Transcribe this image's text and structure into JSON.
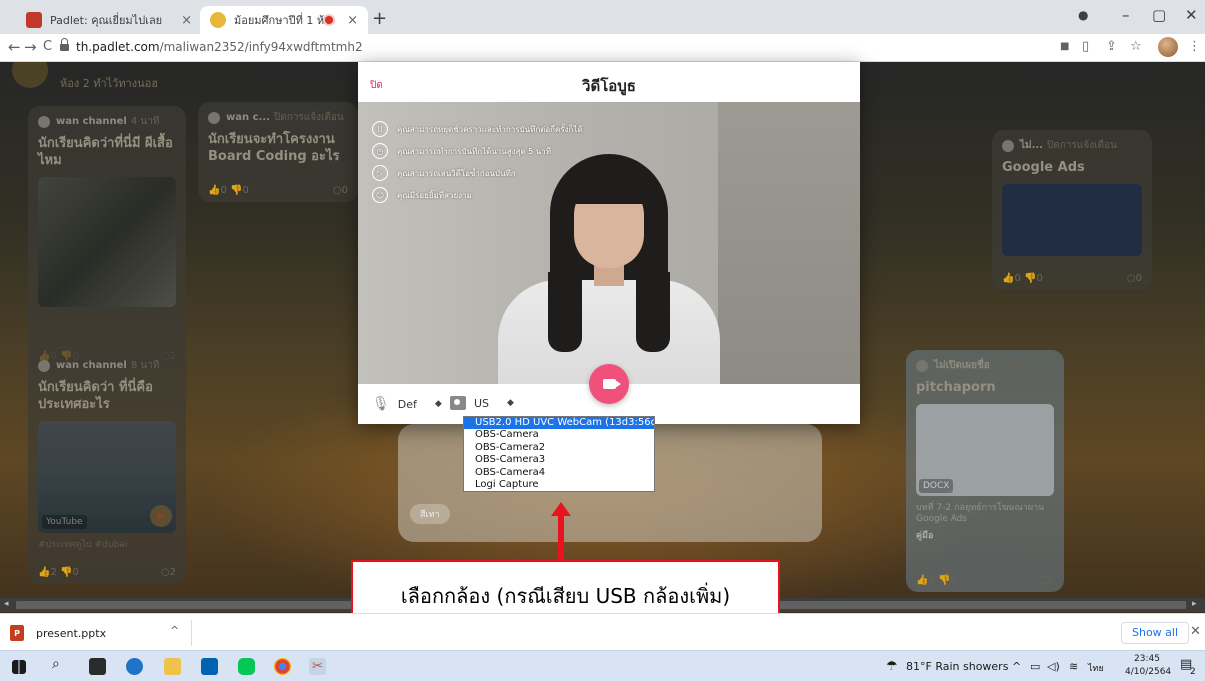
{
  "browser": {
    "tabs": [
      {
        "title": "Padlet: คุณเยี่ยมไปเลย",
        "close": "×"
      },
      {
        "title": "ม้อยมศึกษาปีที่ 1 ห้อง 2",
        "close": "×"
      }
    ],
    "new_tab": "+",
    "url_domain": "th.padlet.com",
    "url_path": "/maliwan2352/infy94xwdftmtmh2",
    "window_controls": {
      "minimize": "–",
      "maximize": "▢",
      "close": "✕"
    },
    "nav": {
      "back": "←",
      "forward": "→",
      "reload": "C"
    },
    "star": "☆",
    "menu": "⋮"
  },
  "padlet": {
    "subtitle": "ห้อง 2 ทำไว้ทางนอฮ",
    "cards": [
      {
        "author": "wan channel",
        "time": "4 นาที",
        "title": "นักเรียนคิดว่าที่นี่มี ผีเสื้อไหม",
        "likes": "0",
        "dislikes": "0",
        "comments": "2"
      },
      {
        "author": "wan c...",
        "time": "ปิดการแจ้งเตือน",
        "title": "นักเรียนจะทำโครงงาน Board Coding อะไร",
        "likes": "0",
        "dislikes": "0",
        "comments": "0"
      },
      {
        "author": "wan channel",
        "time": "8 นาที",
        "title": "นักเรียนคิดว่า ที่นี่คือ ประเทศอะไร",
        "badge": "YouTube",
        "tags": "#ประเทศดูไบ #dubai",
        "likes": "2",
        "dislikes": "0",
        "comments": "2"
      },
      {
        "author": "ไม่...",
        "time": "ปิดการแจ้งเตือน",
        "title": "Google Ads",
        "likes": "0",
        "dislikes": "0",
        "comments": "0"
      },
      {
        "author": "ไม่เปิดเผยชื่อ",
        "time": "8 นาที",
        "title": "pitchaporn",
        "badge": "DOCX",
        "desc": "บทที่ 7-2 กลยุทธ์การโฆษณาผ่าน Google Ads",
        "footer": "คู่มือ",
        "likes": "0",
        "dislikes": "0",
        "comments": "0"
      }
    ],
    "bg_chip": "สีเทา"
  },
  "modal": {
    "close_label": "ปิด",
    "title": "วิดีโอบูธ",
    "tips": [
      {
        "icon": "II",
        "text": "คุณสามารถหยุดชั่วคราวและทำการบันทึกต่อกี่ครั้งก็ได้"
      },
      {
        "icon": "◷",
        "text": "คุณสามารถทำการบันทึกได้นานสูงสุด 5 นาที"
      },
      {
        "icon": "▷",
        "text": "คุณสามารถเล่นวิดีโอซ้ำก่อนบันทึก"
      },
      {
        "icon": "☺",
        "text": "คุณมีรอยยิ้มที่สวยงาม"
      }
    ],
    "mic_select": {
      "value": "Def",
      "caret": "◆"
    },
    "camera_select": {
      "value": "US",
      "caret": "◆"
    },
    "camera_options": [
      "USB2.0 HD UVC WebCam (13d3:56dc)",
      "OBS-Camera",
      "OBS-Camera2",
      "OBS-Camera3",
      "OBS-Camera4",
      "Logi Capture"
    ]
  },
  "annotation": {
    "text": "เลือกกล้อง (กรณีเสียบ USB กล้องเพิ่ม)",
    "color": "#e8131c"
  },
  "downloads": {
    "file": "present.pptx",
    "show_all": "Show all",
    "close": "✕",
    "chevron": "^"
  },
  "taskbar": {
    "weather": "81°F Rain showers",
    "lang": "ไทย",
    "time": "23:45",
    "date": "4/10/2564",
    "notif_count": "2"
  },
  "colors": {
    "accent": "#f0517a",
    "select_highlight": "#1a73e8",
    "annotation": "#e8131c"
  }
}
